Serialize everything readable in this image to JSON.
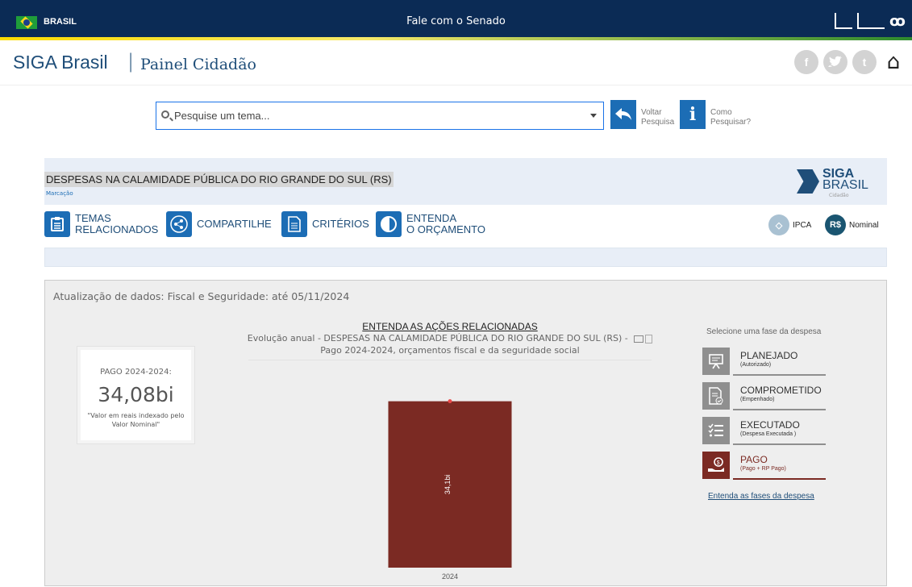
{
  "govbar": {
    "country": "BRASIL",
    "contact": "Fale com o Senado"
  },
  "header": {
    "brand": "SIGA Brasil",
    "separator": "|",
    "subtitle": "Painel Cidadão",
    "social": [
      "f",
      "t",
      "t"
    ]
  },
  "search": {
    "placeholder": "Pesquise um tema...",
    "back_label_1": "Voltar",
    "back_label_2": "Pesquisa",
    "help_label_1": "Como",
    "help_label_2": "Pesquisar?"
  },
  "topic": {
    "title": "DESPESAS NA CALAMIDADE PÚBLICA DO RIO GRANDE DO SUL (RS)",
    "tag": "Marcação",
    "logo_1": "SIGA",
    "logo_2": "BRASIL",
    "logo_3": "Cidadão"
  },
  "actions": {
    "temas_1": "TEMAS",
    "temas_2": "RELACIONADOS",
    "compartilhe": "COMPARTILHE",
    "criterios": "CRITÉRIOS",
    "entenda_1": "ENTENDA",
    "entenda_2": "O ORÇAMENTO",
    "ipca": "IPCA",
    "nominal_badge": "R$",
    "nominal": "Nominal"
  },
  "panel": {
    "update": "Atualização de dados: Fiscal e Seguridade: até 05/11/2024",
    "card_label": "PAGO 2024-2024:",
    "card_value": "34,08bi",
    "card_note": "\"Valor em reais indexado pelo Valor Nominal\"",
    "chart_heading": "ENTENDA  AS AÇÕES RELACIONADAS",
    "chart_sub_1": "Evolução anual - DESPESAS NA CALAMIDADE PÚBLICA DO RIO GRANDE DO SUL (RS) -",
    "chart_sub_2": "Pago 2024-2024, orçamentos fiscal e da seguridade social"
  },
  "phases": {
    "heading": "Selecione uma fase da despesa",
    "items": [
      {
        "title": "PLANEJADO",
        "sub": "(Autorizado)",
        "icon": "presentation-icon"
      },
      {
        "title": "COMPROMETIDO",
        "sub": "(Empenhado)",
        "icon": "document-check-icon"
      },
      {
        "title": "EXECUTADO",
        "sub": "(Despesa Executada )",
        "icon": "checklist-icon"
      },
      {
        "title": "PAGO",
        "sub": "(Pago + RP Pago)",
        "icon": "hand-coin-icon"
      }
    ],
    "link": "Entenda as fases da despesa"
  },
  "colors": {
    "bar": "#7b2a23",
    "accent": "#1c6db5",
    "nav": "#0b2b55"
  },
  "chart_data": {
    "type": "bar",
    "categories": [
      "2024"
    ],
    "values": [
      34.08
    ],
    "data_labels": [
      "34,1bi"
    ],
    "title": "",
    "xlabel": "",
    "ylabel": "",
    "ylim": [
      0,
      36
    ],
    "grid": false
  }
}
